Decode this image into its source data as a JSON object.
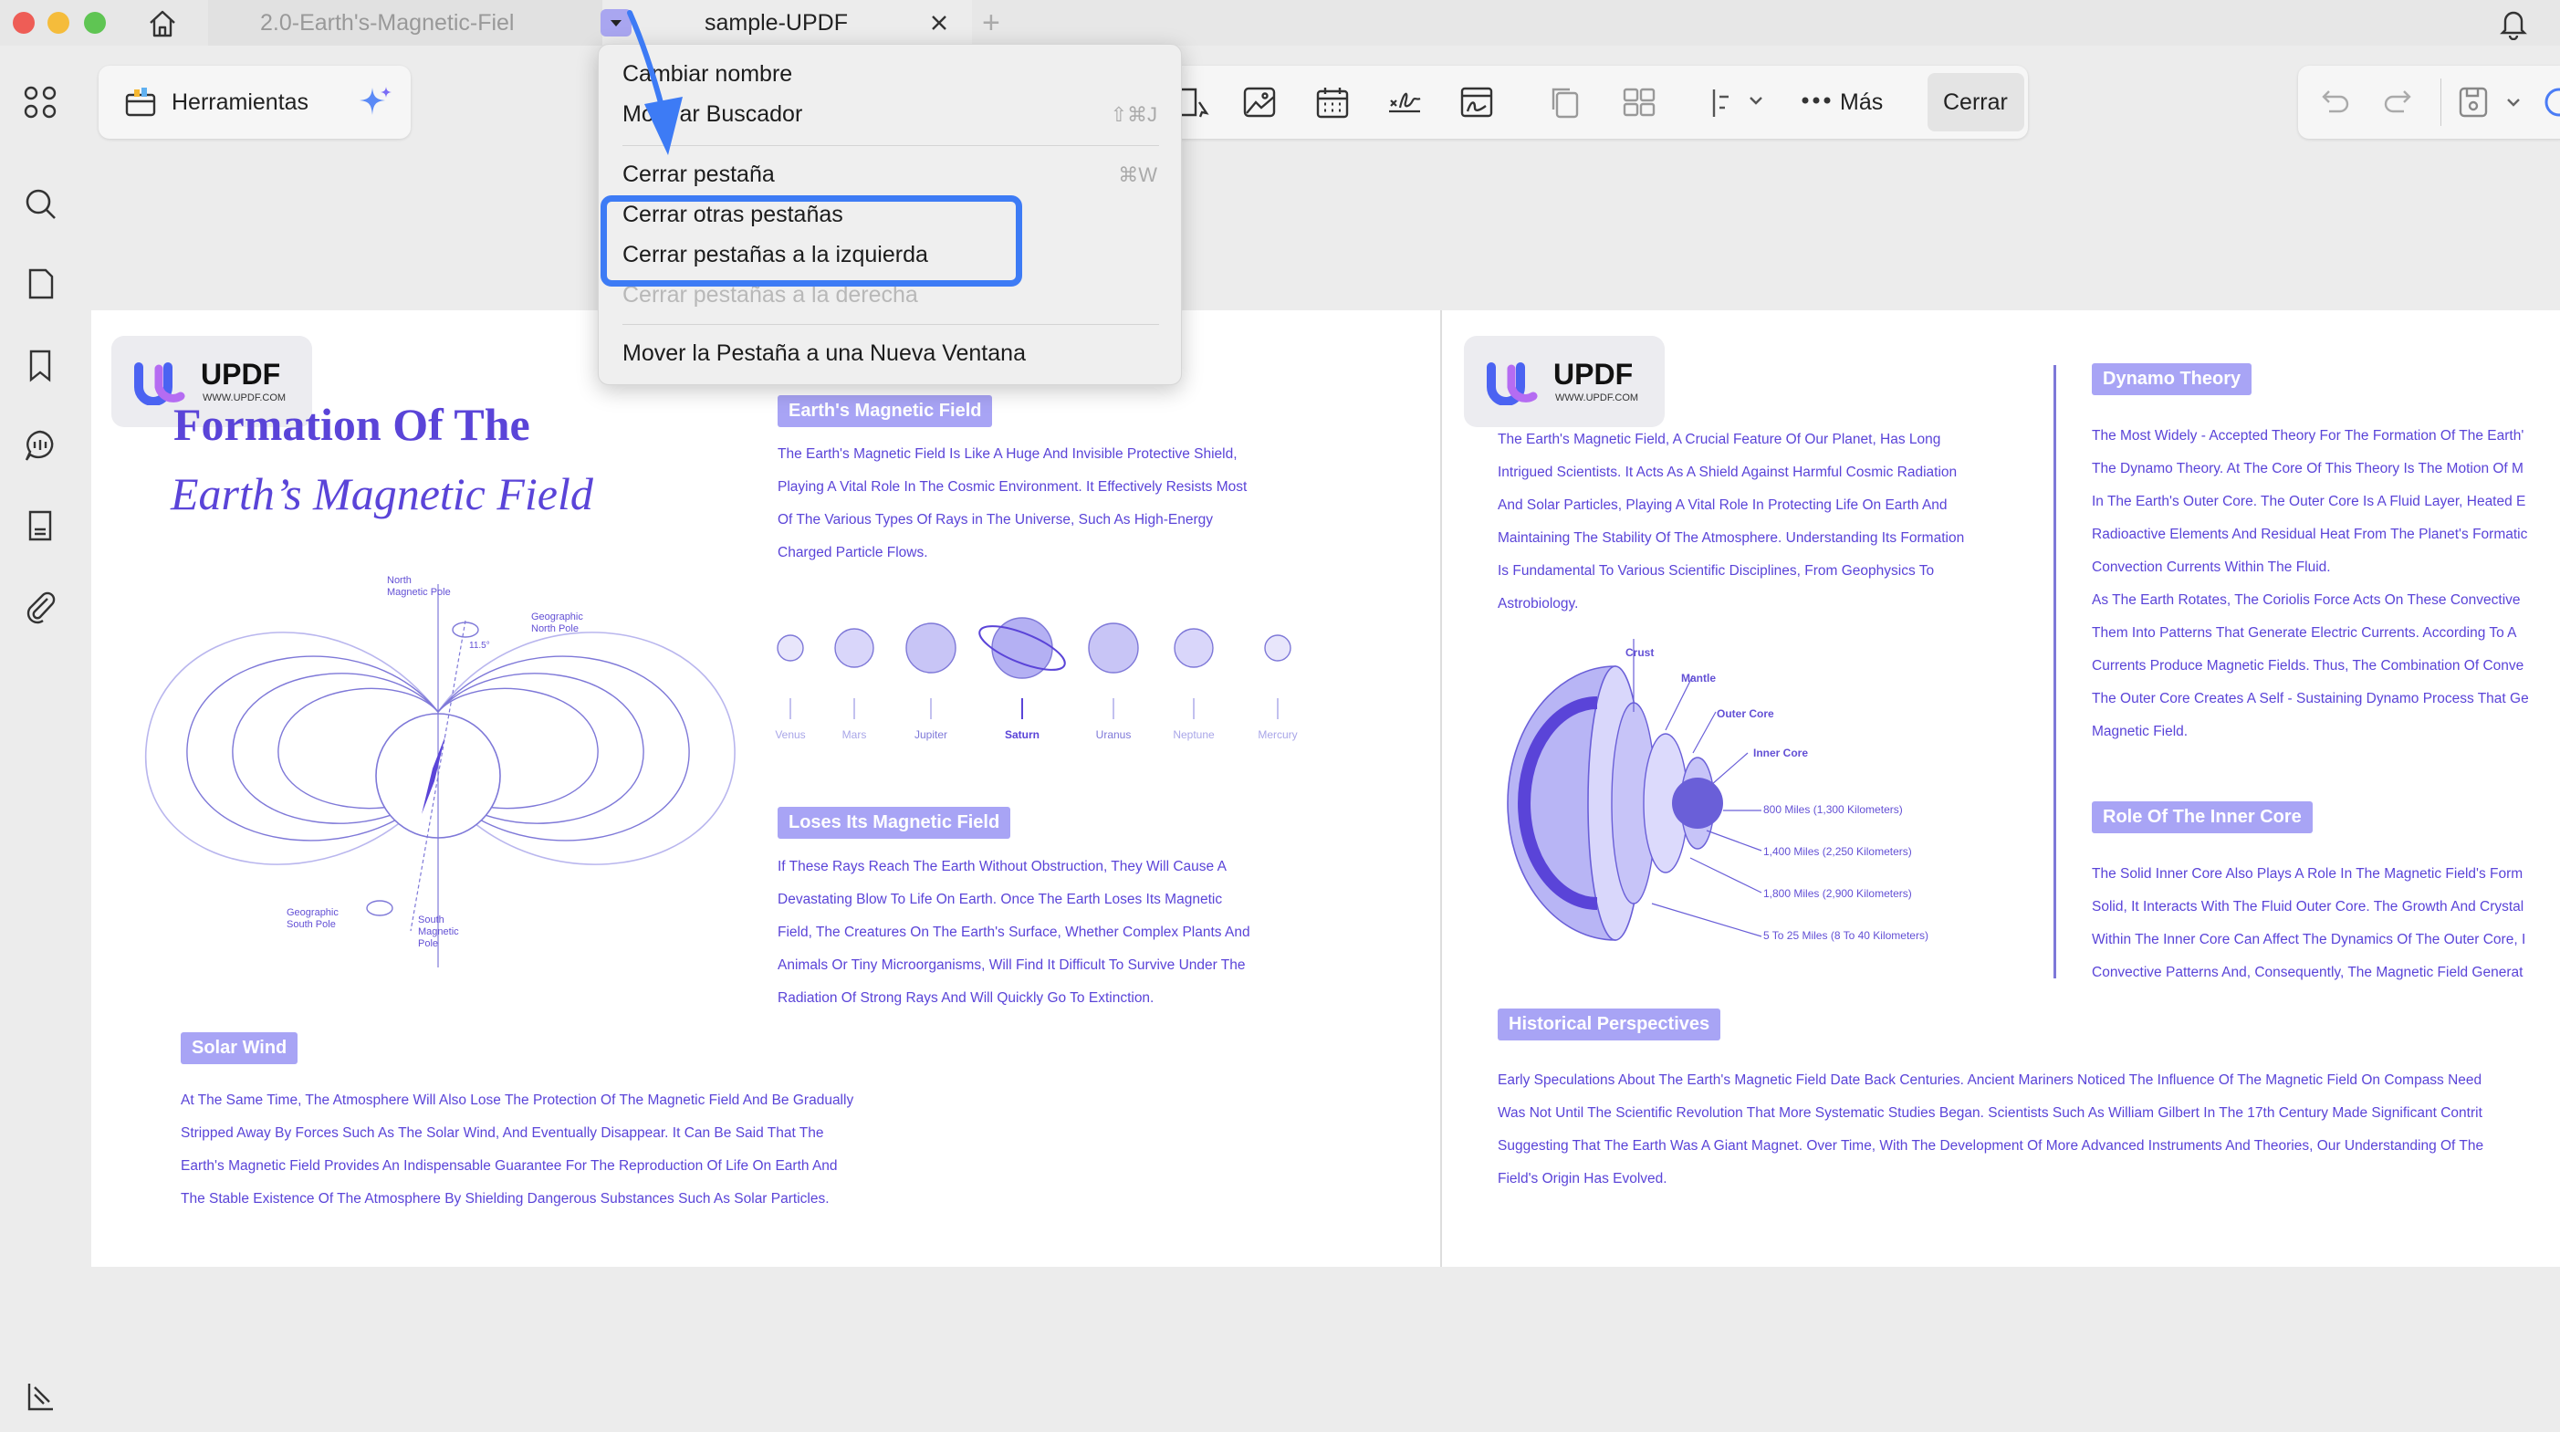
{
  "window": {
    "tabs": [
      {
        "label": "2.0-Earth's-Magnetic-Fiel"
      },
      {
        "label": "sample-UPDF"
      }
    ],
    "new_tab_symbol": "+"
  },
  "toolbar": {
    "herramientas_label": "Herramientas",
    "mas_label": "Más",
    "cerrar_label": "Cerrar"
  },
  "menu": {
    "items": [
      {
        "label": "Cambiar nombre",
        "shortcut": ""
      },
      {
        "label": "Mostrar Buscador",
        "shortcut": "⇧⌘J"
      },
      {
        "label": "Cerrar pestaña",
        "shortcut": "⌘W"
      },
      {
        "label": "Cerrar otras pestañas",
        "shortcut": ""
      },
      {
        "label": "Cerrar pestañas a la izquierda",
        "shortcut": ""
      },
      {
        "label": "Cerrar pestañas a la derecha",
        "shortcut": "",
        "disabled": true
      },
      {
        "label": "Mover la Pestaña a una Nueva Ventana",
        "shortcut": ""
      }
    ],
    "highlight_color": "#3d7bf5"
  },
  "logo": {
    "name": "UPDF",
    "url": "WWW.UPDF.COM"
  },
  "page1": {
    "title_line1": "Formation Of The",
    "title_line2": "Earth’s Magnetic Field",
    "diagram_labels": {
      "north_pole": [
        "North",
        "Magnetic Pole"
      ],
      "geo_north": [
        "Geographic",
        "North Pole"
      ],
      "angle": "11.5°",
      "geo_south": [
        "Geographic",
        "South Pole"
      ],
      "south_pole": [
        "South",
        "Magnetic",
        "Pole"
      ]
    },
    "earths_field": {
      "heading": "Earth's Magnetic Field",
      "lines": [
        "The Earth's Magnetic Field Is Like A Huge And Invisible Protective Shield,",
        "Playing A Vital Role In The Cosmic Environment. It Effectively Resists Most",
        "Of The Various Types Of Rays in The Universe, Such As High-Energy",
        "Charged Particle Flows."
      ]
    },
    "planets": [
      "Venus",
      "Mars",
      "Jupiter",
      "Saturn",
      "Uranus",
      "Neptune",
      "Mercury"
    ],
    "loses": {
      "heading": "Loses Its Magnetic Field",
      "lines": [
        "If These Rays Reach The Earth Without Obstruction, They Will Cause A",
        "Devastating Blow To Life On Earth. Once The Earth Loses Its Magnetic",
        "Field, The Creatures On The Earth's Surface, Whether Complex Plants And",
        "Animals Or Tiny Microorganisms, Will Find It Difficult To Survive Under The",
        "Radiation Of Strong Rays And Will Quickly Go To Extinction."
      ]
    },
    "solar": {
      "heading": "Solar Wind",
      "lines": [
        "At The Same Time, The Atmosphere Will Also Lose The Protection Of The Magnetic Field And Be Gradually",
        "Stripped Away By Forces Such As The Solar Wind, And Eventually Disappear. It Can Be Said That The",
        "Earth's Magnetic Field Provides An Indispensable Guarantee For The Reproduction Of Life On Earth And",
        "The Stable Existence Of The Atmosphere By Shielding Dangerous Substances Such As Solar Particles."
      ]
    }
  },
  "page2": {
    "intro_lines": [
      "The Earth's Magnetic Field, A Crucial Feature Of Our Planet, Has Long",
      "Intrigued Scientists. It Acts As A Shield Against Harmful Cosmic Radiation",
      "And Solar Particles, Playing A Vital Role In Protecting Life On Earth And",
      "Maintaining The Stability Of The Atmosphere. Understanding Its Formation",
      "Is Fundamental To Various Scientific Disciplines, From Geophysics To",
      "Astrobiology."
    ],
    "layers": [
      "Crust",
      "Mantle",
      "Outer Core",
      "Inner Core"
    ],
    "depths": [
      "800 Miles (1,300 Kilometers)",
      "1,400 Miles (2,250 Kilometers)",
      "1,800 Miles (2,900 Kilometers)",
      "5 To 25 Miles (8 To 40 Kilometers)"
    ],
    "dynamo": {
      "heading": "Dynamo Theory",
      "lines": [
        "The Most Widely - Accepted Theory For The Formation Of The Earth'",
        "The Dynamo Theory. At The Core Of This Theory Is The Motion Of M",
        "In The Earth's Outer Core. The Outer Core Is A Fluid Layer, Heated E",
        "Radioactive Elements And Residual Heat From The Planet's Formatic",
        "Convection Currents Within The Fluid.",
        "As The Earth Rotates, The Coriolis Force Acts On These Convective",
        "Them Into Patterns That Generate Electric Currents. According To A",
        "Currents Produce Magnetic Fields. Thus, The Combination Of Conve",
        "The Outer Core Creates A Self - Sustaining Dynamo Process That Ge",
        "Magnetic Field."
      ]
    },
    "inner": {
      "heading": "Role Of The Inner Core",
      "lines": [
        "The Solid Inner Core Also Plays A Role In The Magnetic Field's Form",
        "Solid, It Interacts With The Fluid Outer Core. The Growth And Crystal",
        "Within The Inner Core Can Affect The Dynamics Of The Outer Core, I",
        "Convective Patterns And, Consequently, The Magnetic Field Generat"
      ]
    },
    "historical": {
      "heading": "Historical Perspectives",
      "lines": [
        "Early Speculations About The Earth's Magnetic Field Date Back Centuries. Ancient Mariners Noticed The Influence Of The Magnetic Field On Compass Need",
        "Was Not Until The Scientific Revolution That More Systematic Studies Began. Scientists Such As William Gilbert In The 17th Century Made Significant Contrit",
        "Suggesting That The Earth Was A Giant Magnet. Over Time, With The Development Of More Advanced Instruments And Theories, Our Understanding Of The",
        "Field's Origin Has Evolved."
      ]
    }
  }
}
